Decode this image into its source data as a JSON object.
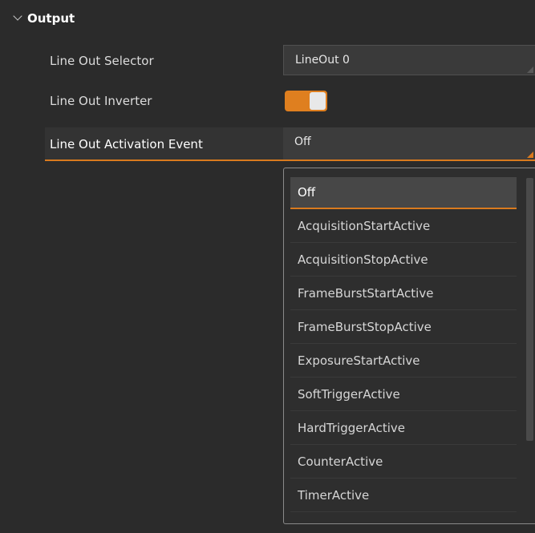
{
  "section": {
    "title": "Output",
    "chevron_icon": "chevron-down-icon"
  },
  "rows": [
    {
      "label": "Line Out Selector",
      "value": "LineOut 0"
    },
    {
      "label": "Line Out Inverter",
      "toggle_on": true
    },
    {
      "label": "Line Out Activation Event",
      "value": "Off"
    }
  ],
  "dropdown": {
    "selected": "Off",
    "options": [
      "Off",
      "AcquisitionStartActive",
      "AcquisitionStopActive",
      "FrameBurstStartActive",
      "FrameBurstStopActive",
      "ExposureStartActive",
      "SoftTriggerActive",
      "HardTriggerActive",
      "CounterActive",
      "TimerActive"
    ]
  },
  "colors": {
    "accent": "#d97a1e",
    "background": "#2b2b2b",
    "field": "#3a3a3a"
  }
}
